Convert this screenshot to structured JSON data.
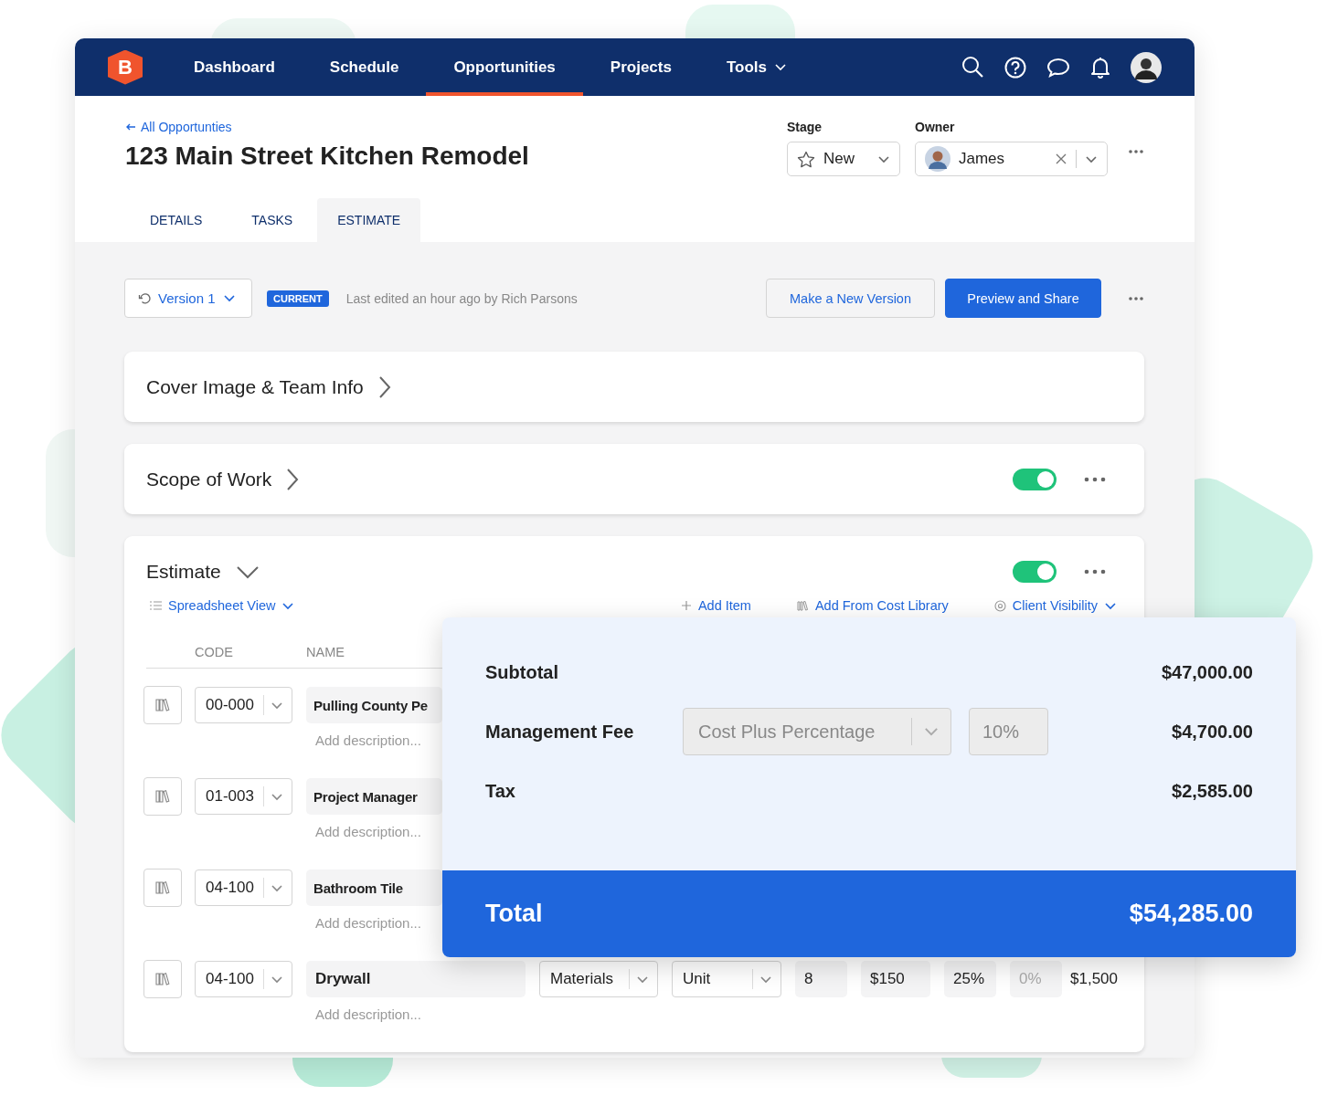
{
  "nav": {
    "logo": "B",
    "items": [
      {
        "label": "Dashboard",
        "selected": false,
        "dropdown": false
      },
      {
        "label": "Schedule",
        "selected": false,
        "dropdown": false
      },
      {
        "label": "Opportunities",
        "selected": true,
        "dropdown": false
      },
      {
        "label": "Projects",
        "selected": false,
        "dropdown": false
      },
      {
        "label": "Tools",
        "selected": false,
        "dropdown": true
      }
    ]
  },
  "header": {
    "back_link": "All Opportunties",
    "title": "123 Main Street Kitchen Remodel",
    "stage": {
      "label": "Stage",
      "value": "New"
    },
    "owner": {
      "label": "Owner",
      "value": "James"
    }
  },
  "tabs": [
    {
      "label": "DETAILS",
      "selected": false
    },
    {
      "label": "TASKS",
      "selected": false
    },
    {
      "label": "ESTIMATE",
      "selected": true
    }
  ],
  "version_bar": {
    "version": "Version 1",
    "badge": "CURRENT",
    "edited": "Last edited an hour ago by Rich Parsons",
    "buttons": [
      {
        "label": "Make a New Version",
        "kind": "secondary"
      },
      {
        "label": "Preview and Share",
        "kind": "primary"
      }
    ]
  },
  "sections": [
    {
      "title": "Cover Image & Team Info",
      "kind": "plain",
      "expanded": false
    },
    {
      "title": "Scope of Work",
      "kind": "toggle",
      "expanded": false,
      "on": true
    },
    {
      "title": "Estimate",
      "kind": "toggle",
      "expanded": true,
      "on": true
    }
  ],
  "estimate": {
    "view": "Spreadsheet View",
    "actions": [
      "Add Item",
      "Add From Cost Library",
      "Client Visibility"
    ],
    "columns": [
      "CODE",
      "NAME"
    ],
    "rows": [
      {
        "code": "00-000",
        "name": "Pulling County Pe",
        "description_placeholder": "Add description..."
      },
      {
        "code": "01-003",
        "name": "Project Manager",
        "description_placeholder": "Add description..."
      },
      {
        "code": "04-100",
        "name": "Bathroom Tile",
        "description_placeholder": "Add description..."
      },
      {
        "code": "04-100",
        "name": "Drywall",
        "description_placeholder": "Add description...",
        "type": "Materials",
        "unit": "Unit",
        "quantity": "8",
        "unit_cost": "$150",
        "markup": "25%",
        "tax_placeholder": "0%",
        "total": "$1,500"
      }
    ]
  },
  "summary": {
    "lines": [
      {
        "label": "Subtotal",
        "amount": "$47,000.00"
      },
      {
        "label": "Management Fee",
        "method": "Cost Plus Percentage",
        "rate": "10%",
        "amount": "$4,700.00"
      },
      {
        "label": "Tax",
        "amount": "$2,585.00"
      }
    ],
    "total": {
      "label": "Total",
      "amount": "$54,285.00"
    }
  }
}
